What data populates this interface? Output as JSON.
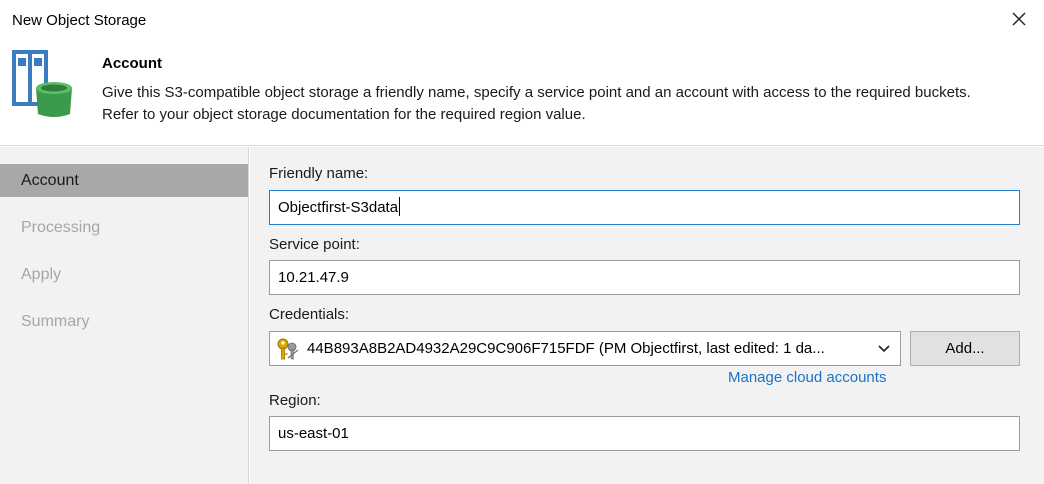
{
  "window": {
    "title": "New Object Storage"
  },
  "header": {
    "title": "Account",
    "description": "Give this S3-compatible object storage a friendly name, specify a service point and an account with access to the required buckets. Refer to your object storage documentation for the required region value."
  },
  "sidebar": {
    "items": [
      {
        "label": "Account",
        "active": true
      },
      {
        "label": "Processing",
        "active": false
      },
      {
        "label": "Apply",
        "active": false
      },
      {
        "label": "Summary",
        "active": false
      }
    ]
  },
  "form": {
    "friendly_name": {
      "label": "Friendly name:",
      "value": "Objectfirst-S3data"
    },
    "service_point": {
      "label": "Service point:",
      "value": "10.21.47.9"
    },
    "credentials": {
      "label": "Credentials:",
      "value": "44B893A8B2AD4932A29C9C906F715FDF (PM Objectfirst, last edited: 1 da...",
      "add_label": "Add...",
      "manage_link": "Manage cloud accounts"
    },
    "region": {
      "label": "Region:",
      "value": "us-east-01"
    }
  },
  "colors": {
    "accent": "#1f7fd0",
    "link": "#1a73c9",
    "sidebar_active": "#a8a8a8",
    "panel_bg": "#f2f2f2"
  }
}
